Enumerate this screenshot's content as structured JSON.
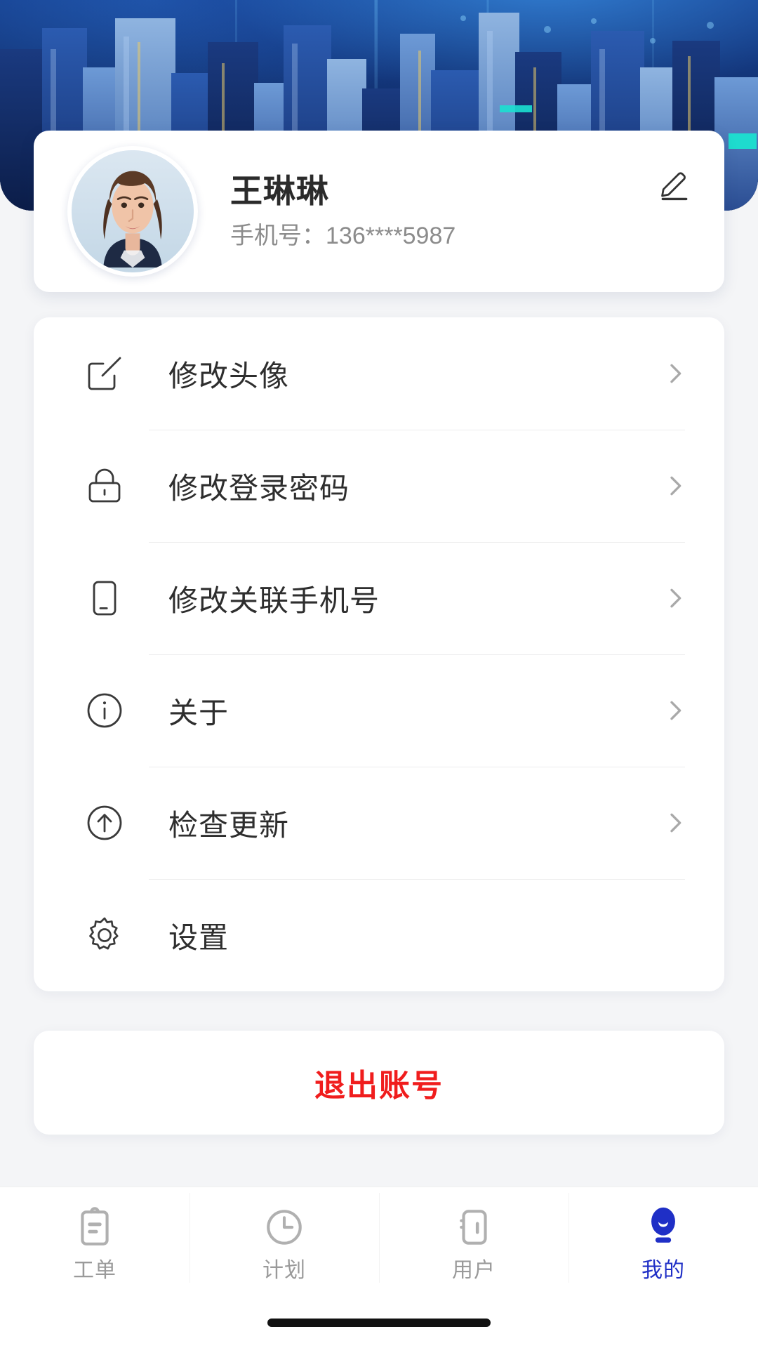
{
  "theme": {
    "accent": "#1f2fc6",
    "danger": "#f01d1d",
    "text_primary": "#2e2e2e",
    "text_muted": "#8c8c8c",
    "card_bg": "#ffffff",
    "page_bg": "#f4f5f7",
    "banner_dark": "#0d2456",
    "banner_light": "#3c96eb"
  },
  "banner": {
    "name": "city-skyline-banner"
  },
  "profile": {
    "avatar_icon": "user-avatar-photo",
    "name": "王琳琳",
    "phone": "手机号：136****5987",
    "edit_icon": "pencil-edit-icon"
  },
  "menu": {
    "items": [
      {
        "label": "修改头像",
        "icon": "edit-square-icon",
        "chevron": "chevron-right-icon"
      },
      {
        "label": "修改登录密码",
        "icon": "lock-icon",
        "chevron": "chevron-right-icon"
      },
      {
        "label": "修改关联手机号",
        "icon": "mobile-phone-icon",
        "chevron": "chevron-right-icon"
      },
      {
        "label": "关于",
        "icon": "info-circle-icon",
        "chevron": "chevron-right-icon"
      },
      {
        "label": "检查更新",
        "icon": "arrow-up-circle-icon",
        "chevron": "chevron-right-icon"
      },
      {
        "label": "设置",
        "icon": "gear-icon",
        "chevron": ""
      }
    ]
  },
  "logout": {
    "label": "退出账号"
  },
  "tabbar": {
    "items": [
      {
        "label": "工单",
        "icon": "clipboard-icon",
        "active": false
      },
      {
        "label": "计划",
        "icon": "clock-icon",
        "active": false
      },
      {
        "label": "用户",
        "icon": "id-card-icon",
        "active": false
      },
      {
        "label": "我的",
        "icon": "person-icon",
        "active": true
      }
    ]
  }
}
